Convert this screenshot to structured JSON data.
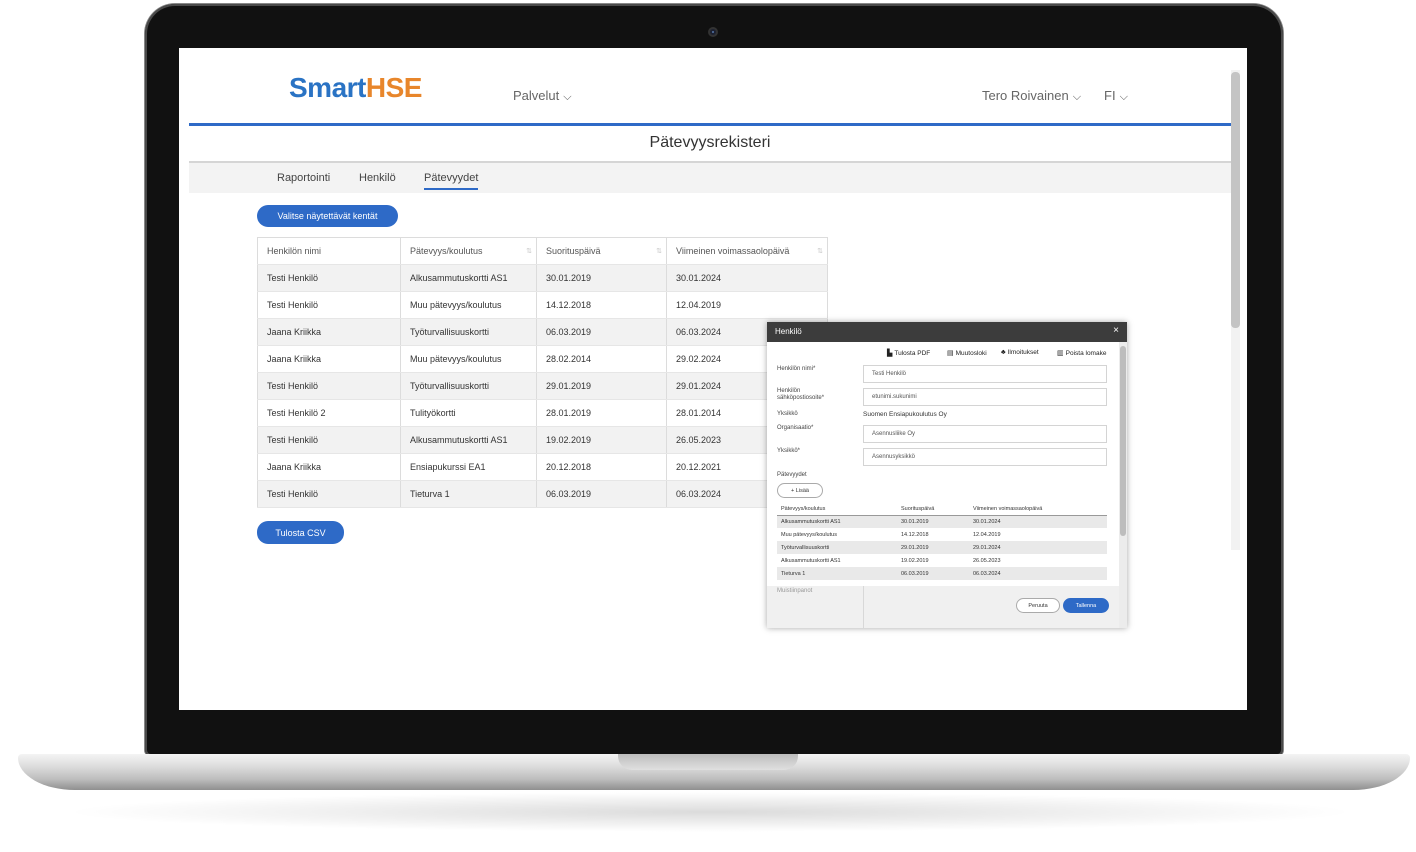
{
  "logo": {
    "part1": "Smart",
    "part2": "HSE"
  },
  "nav": {
    "services": "Palvelut",
    "user": "Tero Roivainen",
    "language": "FI"
  },
  "page_title": "Pätevyysrekisteri",
  "tabs": [
    {
      "label": "Raportointi",
      "active": false
    },
    {
      "label": "Henkilö",
      "active": false
    },
    {
      "label": "Pätevyydet",
      "active": true
    }
  ],
  "select_fields_button": "Valitse näytettävät kentät",
  "print_csv_button": "Tulosta CSV",
  "table": {
    "headers": [
      "Henkilön nimi",
      "Pätevyys/koulutus",
      "Suorituspäivä",
      "Viimeinen voimassaolopäivä"
    ],
    "rows": [
      [
        "Testi Henkilö",
        "Alkusammutuskortti AS1",
        "30.01.2019",
        "30.01.2024"
      ],
      [
        "Testi Henkilö",
        "Muu pätevyys/koulutus",
        "14.12.2018",
        "12.04.2019"
      ],
      [
        "Jaana Kriikka",
        "Työturvallisuuskortti",
        "06.03.2019",
        "06.03.2024"
      ],
      [
        "Jaana Kriikka",
        "Muu pätevyys/koulutus",
        "28.02.2014",
        "29.02.2024"
      ],
      [
        "Testi Henkilö",
        "Työturvallisuuskortti",
        "29.01.2019",
        "29.01.2024"
      ],
      [
        "Testi Henkilö 2",
        "Tulityökortti",
        "28.01.2019",
        "28.01.2014"
      ],
      [
        "Testi Henkilö",
        "Alkusammutuskortti AS1",
        "19.02.2019",
        "26.05.2023"
      ],
      [
        "Jaana Kriikka",
        "Ensiapukurssi EA1",
        "20.12.2018",
        "20.12.2021"
      ],
      [
        "Testi Henkilö",
        "Tieturva 1",
        "06.03.2019",
        "06.03.2024"
      ]
    ]
  },
  "dialog": {
    "title": "Henkilö",
    "close": "×",
    "actions": [
      {
        "icon": "document-icon",
        "glyph": "▙",
        "label": "Tulosta PDF"
      },
      {
        "icon": "list-icon",
        "glyph": "▤",
        "label": "Muutosloki"
      },
      {
        "icon": "bell-icon",
        "glyph": "♣",
        "label": "Ilmoitukset"
      },
      {
        "icon": "trash-icon",
        "glyph": "▥",
        "label": "Poista lomake"
      }
    ],
    "fields": {
      "name_label": "Henkilön nimi*",
      "name_value": "Testi Henkilö",
      "email_label_1": "Henkilön",
      "email_label_2": "sähköpostiosoite*",
      "email_value": "etunimi.sukunimi",
      "unit_label": "Yksikkö",
      "unit_value": "Suomen Ensiapukoulutus Oy",
      "org_label": "Organisaatio*",
      "org_value": "Asennusliike Oy",
      "unit2_label": "Yksikkö*",
      "unit2_value": "Asennusyksikkö",
      "competencies_label": "Pätevyydet",
      "add_button": "+ Lisää"
    },
    "sub_table": {
      "headers": [
        "Pätevyys/koulutus",
        "Suorituspäivä",
        "Viimeinen voimassaolopäivä"
      ],
      "rows": [
        [
          "Alkusammutuskortti AS1",
          "30.01.2019",
          "30.01.2024"
        ],
        [
          "Muu pätevyys/koulutus",
          "14.12.2018",
          "12.04.2019"
        ],
        [
          "Työturvallisuuskortti",
          "29.01.2019",
          "29.01.2024"
        ],
        [
          "Alkusammutuskortti AS1",
          "19.02.2019",
          "26.05.2023"
        ],
        [
          "Tieturva 1",
          "06.03.2019",
          "06.03.2024"
        ]
      ]
    },
    "notes_label": "Muistiinpanot",
    "cancel_button": "Peruuta",
    "save_button": "Tallenna"
  },
  "colors": {
    "brand_blue": "#2a73c4",
    "brand_orange": "#e8862b",
    "accent": "#2e6ac7",
    "dialog_header": "#3c3c3c"
  }
}
